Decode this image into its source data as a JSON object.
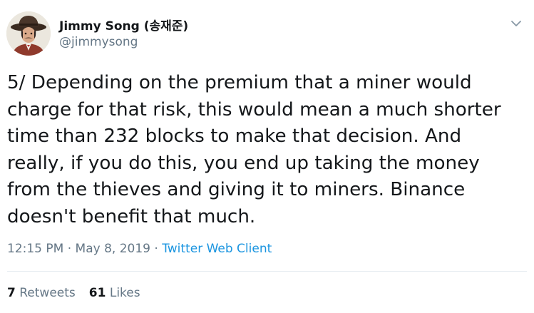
{
  "author": {
    "name": "Jimmy Song (송재준)",
    "handle": "@jimmysong"
  },
  "tweet": {
    "text": "5/ Depending on the premium that a miner would\ncharge for that risk, this would mean a much shorter\ntime than 232 blocks to make that decision. And\nreally, if you do this, you end up taking the money\nfrom the thieves and giving it to miners. Binance\ndoesn't benefit that much."
  },
  "meta": {
    "time": "12:15 PM",
    "separator": " · ",
    "date": "May 8, 2019",
    "source": "Twitter Web Client"
  },
  "stats": {
    "retweets_count": "7",
    "retweets_label": " Retweets",
    "likes_count": "61",
    "likes_label": " Likes"
  },
  "icons": {
    "caret": "chevron-down-icon"
  },
  "colors": {
    "text": "#14171a",
    "muted": "#657786",
    "link": "#1b95e0",
    "divider": "#e6ecf0"
  }
}
